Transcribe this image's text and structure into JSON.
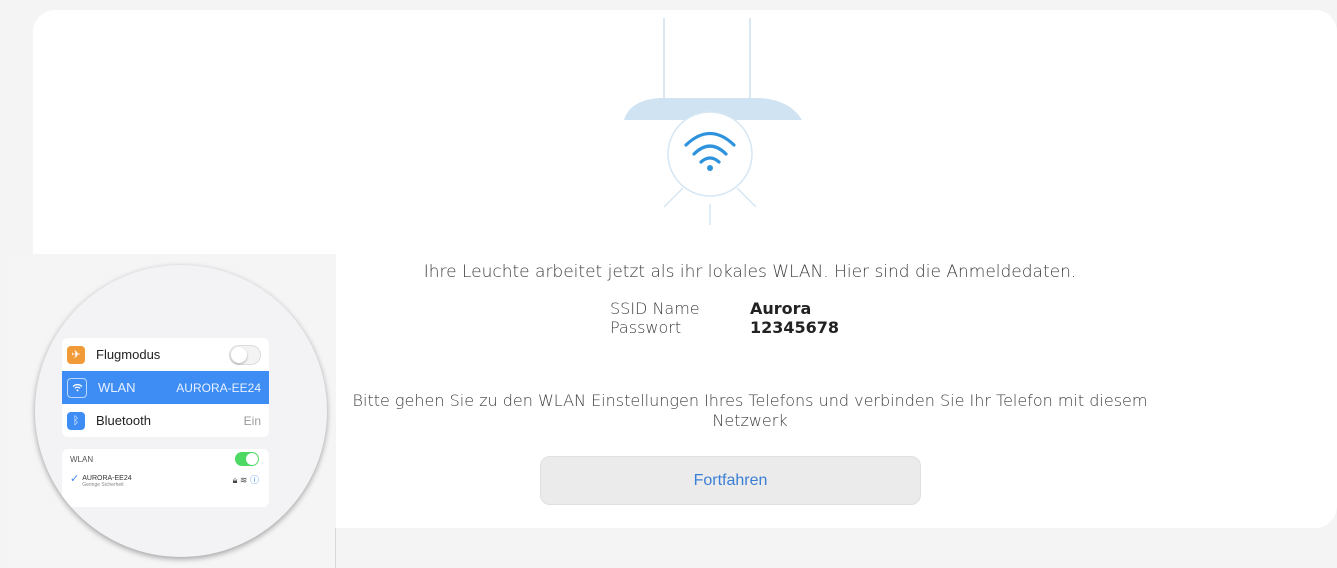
{
  "intro_text": "Ihre Leuchte arbeitet jetzt als ihr lokales WLAN. Hier sind die Anmeldedaten.",
  "credentials": {
    "ssid_label": "SSID Name",
    "ssid_value": "Aurora",
    "password_label": "Passwort",
    "password_value": "12345678"
  },
  "instruction_text": "Bitte gehen Sie zu den WLAN Einstellungen Ihres Telefons und verbinden Sie Ihr Telefon mit diesem Netzwerk",
  "continue_label": "Fortfahren",
  "phone_settings": {
    "rows": [
      {
        "label": "Flugmodus",
        "value": "",
        "icon": "airplane-icon"
      },
      {
        "label": "WLAN",
        "value": "AURORA-EE24",
        "icon": "wifi-icon"
      },
      {
        "label": "Bluetooth",
        "value": "Ein",
        "icon": "bluetooth-icon"
      }
    ],
    "wlan_panel": {
      "header": "WLAN",
      "network_name": "AURORA-EE24",
      "network_sub": "Geringe Sicherheit"
    }
  },
  "colors": {
    "accent_blue": "#3a7fd5",
    "lamp_blue": "#cfe3f2",
    "selected_row": "#3d8df5",
    "toggle_green": "#4cd964"
  }
}
